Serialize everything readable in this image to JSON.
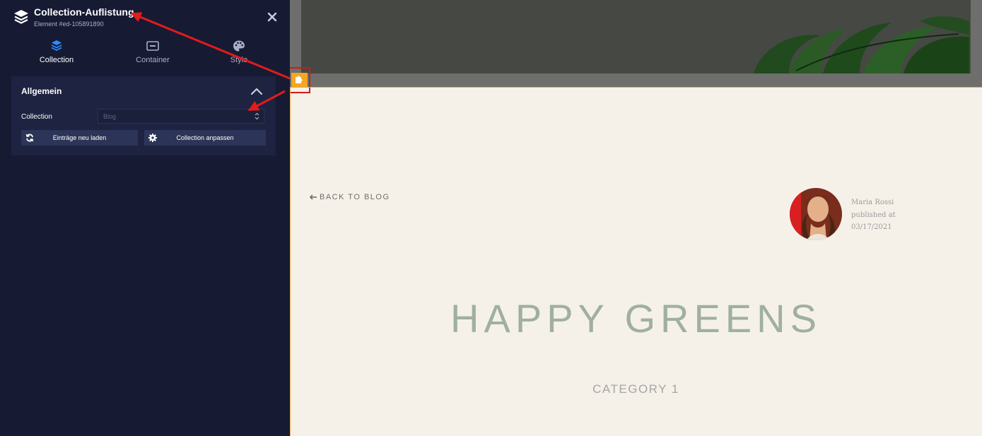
{
  "panel": {
    "title": "Collection-Auflistung",
    "subtitle": "Element #ed-105891890",
    "header_icon": "layers-icon",
    "close_icon": "close-icon",
    "tabs": [
      {
        "label": "Collection",
        "icon": "layers-icon",
        "active": true
      },
      {
        "label": "Container",
        "icon": "container-icon",
        "active": false
      },
      {
        "label": "Style",
        "icon": "palette-icon",
        "active": false
      }
    ],
    "section": {
      "title": "Allgemein",
      "collapse_icon": "chevron-up-icon",
      "field_label": "Collection",
      "select_value": "Blog",
      "buttons": [
        {
          "label": "Einträge neu laden",
          "icon": "refresh-icon"
        },
        {
          "label": "Collection anpassen",
          "icon": "gear-icon"
        }
      ]
    }
  },
  "preview": {
    "back_link": "BACK TO BLOG",
    "author": {
      "name": "Maria Rossi",
      "published_label": "published at",
      "date": "03/17/2021"
    },
    "post_title": "HAPPY GREENS",
    "category": "CATEGORY 1",
    "selection_badge_icon": "puzzle-icon"
  },
  "colors": {
    "panel_bg": "#161b33",
    "section_bg": "#1d2340",
    "button_bg": "#2c3557",
    "accent_blue": "#2f8cff",
    "selection_orange": "#f5a623",
    "annotation_red": "#e31b1b",
    "page_bg": "#f5f1e9",
    "title_green": "#a0b09f"
  }
}
